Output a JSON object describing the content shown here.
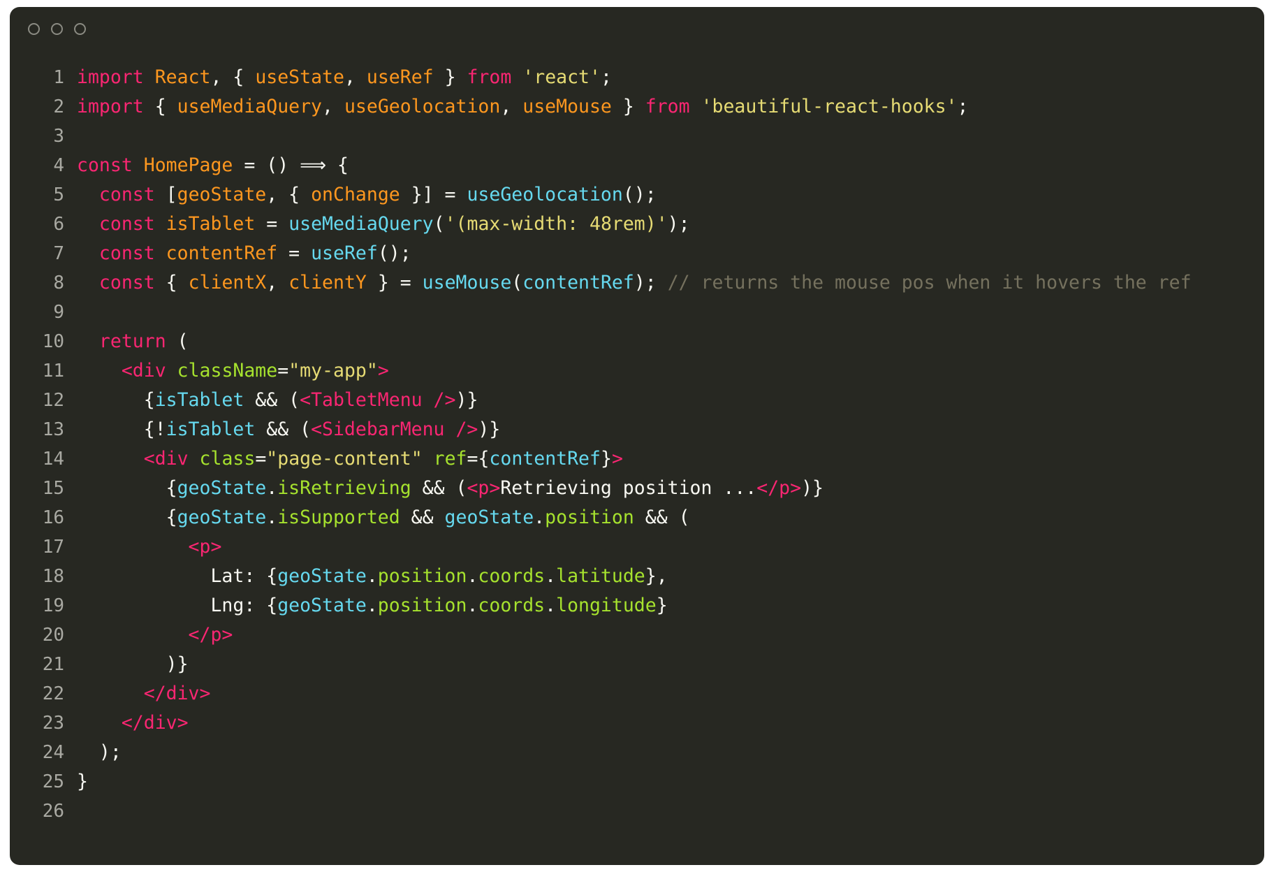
{
  "window": {
    "title_bar": {
      "buttons": [
        {
          "name": "close-button",
          "icon": "circle-outline-icon"
        },
        {
          "name": "minimize-button",
          "icon": "circle-outline-icon"
        },
        {
          "name": "maximize-button",
          "icon": "circle-outline-icon"
        }
      ]
    },
    "background": "#272822",
    "page_background": "#ffffff"
  },
  "editor": {
    "language": "jsx",
    "total_lines": 26,
    "gutter_color": "#a9a9a2",
    "colors": {
      "keyword": "#f92672",
      "identifier": "#fd971f",
      "string": "#e6db74",
      "function": "#66d9ef",
      "property": "#a6e22e",
      "punctuation": "#f8f8f2",
      "comment": "#75715e",
      "tag": "#f92672"
    },
    "lines": [
      {
        "number": "1",
        "tokens": [
          {
            "t": "import",
            "c": "kw"
          },
          {
            "t": " ",
            "c": "punc"
          },
          {
            "t": "React",
            "c": "id"
          },
          {
            "t": ", { ",
            "c": "punc"
          },
          {
            "t": "useState",
            "c": "id"
          },
          {
            "t": ", ",
            "c": "punc"
          },
          {
            "t": "useRef",
            "c": "id"
          },
          {
            "t": " } ",
            "c": "punc"
          },
          {
            "t": "from",
            "c": "kw"
          },
          {
            "t": " ",
            "c": "punc"
          },
          {
            "t": "'react'",
            "c": "str"
          },
          {
            "t": ";",
            "c": "punc"
          }
        ]
      },
      {
        "number": "2",
        "tokens": [
          {
            "t": "import",
            "c": "kw"
          },
          {
            "t": " { ",
            "c": "punc"
          },
          {
            "t": "useMediaQuery",
            "c": "id"
          },
          {
            "t": ", ",
            "c": "punc"
          },
          {
            "t": "useGeolocation",
            "c": "id"
          },
          {
            "t": ", ",
            "c": "punc"
          },
          {
            "t": "useMouse",
            "c": "id"
          },
          {
            "t": " } ",
            "c": "punc"
          },
          {
            "t": "from",
            "c": "kw"
          },
          {
            "t": " ",
            "c": "punc"
          },
          {
            "t": "'beautiful-react-hooks'",
            "c": "str"
          },
          {
            "t": ";",
            "c": "punc"
          }
        ]
      },
      {
        "number": "3",
        "tokens": []
      },
      {
        "number": "4",
        "tokens": [
          {
            "t": "const",
            "c": "kw"
          },
          {
            "t": " ",
            "c": "punc"
          },
          {
            "t": "HomePage",
            "c": "id"
          },
          {
            "t": " = () ⟹ {",
            "c": "punc"
          }
        ]
      },
      {
        "number": "5",
        "tokens": [
          {
            "t": "  ",
            "c": "punc"
          },
          {
            "t": "const",
            "c": "kw"
          },
          {
            "t": " [",
            "c": "punc"
          },
          {
            "t": "geoState",
            "c": "id"
          },
          {
            "t": ", { ",
            "c": "punc"
          },
          {
            "t": "onChange",
            "c": "id"
          },
          {
            "t": " }] = ",
            "c": "punc"
          },
          {
            "t": "useGeolocation",
            "c": "fn"
          },
          {
            "t": "();",
            "c": "punc"
          }
        ]
      },
      {
        "number": "6",
        "tokens": [
          {
            "t": "  ",
            "c": "punc"
          },
          {
            "t": "const",
            "c": "kw"
          },
          {
            "t": " ",
            "c": "punc"
          },
          {
            "t": "isTablet",
            "c": "id"
          },
          {
            "t": " = ",
            "c": "punc"
          },
          {
            "t": "useMediaQuery",
            "c": "fn"
          },
          {
            "t": "(",
            "c": "punc"
          },
          {
            "t": "'(max-width: 48rem)'",
            "c": "str"
          },
          {
            "t": ");",
            "c": "punc"
          }
        ]
      },
      {
        "number": "7",
        "tokens": [
          {
            "t": "  ",
            "c": "punc"
          },
          {
            "t": "const",
            "c": "kw"
          },
          {
            "t": " ",
            "c": "punc"
          },
          {
            "t": "contentRef",
            "c": "id"
          },
          {
            "t": " = ",
            "c": "punc"
          },
          {
            "t": "useRef",
            "c": "fn"
          },
          {
            "t": "();",
            "c": "punc"
          }
        ]
      },
      {
        "number": "8",
        "tokens": [
          {
            "t": "  ",
            "c": "punc"
          },
          {
            "t": "const",
            "c": "kw"
          },
          {
            "t": " { ",
            "c": "punc"
          },
          {
            "t": "clientX",
            "c": "id"
          },
          {
            "t": ", ",
            "c": "punc"
          },
          {
            "t": "clientY",
            "c": "id"
          },
          {
            "t": " } = ",
            "c": "punc"
          },
          {
            "t": "useMouse",
            "c": "fn"
          },
          {
            "t": "(",
            "c": "punc"
          },
          {
            "t": "contentRef",
            "c": "fn"
          },
          {
            "t": "); ",
            "c": "punc"
          },
          {
            "t": "// returns the mouse pos when it hovers the ref",
            "c": "cmt"
          }
        ]
      },
      {
        "number": "9",
        "tokens": []
      },
      {
        "number": "10",
        "tokens": [
          {
            "t": "  ",
            "c": "punc"
          },
          {
            "t": "return",
            "c": "kw"
          },
          {
            "t": " (",
            "c": "punc"
          }
        ]
      },
      {
        "number": "11",
        "tokens": [
          {
            "t": "    ",
            "c": "punc"
          },
          {
            "t": "<div",
            "c": "tag"
          },
          {
            "t": " ",
            "c": "punc"
          },
          {
            "t": "className",
            "c": "attr"
          },
          {
            "t": "=",
            "c": "punc"
          },
          {
            "t": "\"my-app\"",
            "c": "str"
          },
          {
            "t": ">",
            "c": "tag"
          }
        ]
      },
      {
        "number": "12",
        "tokens": [
          {
            "t": "      {",
            "c": "punc"
          },
          {
            "t": "isTablet",
            "c": "fn"
          },
          {
            "t": " && (",
            "c": "punc"
          },
          {
            "t": "<TabletMenu />",
            "c": "tag"
          },
          {
            "t": ")}",
            "c": "punc"
          }
        ]
      },
      {
        "number": "13",
        "tokens": [
          {
            "t": "      {!",
            "c": "punc"
          },
          {
            "t": "isTablet",
            "c": "fn"
          },
          {
            "t": " && (",
            "c": "punc"
          },
          {
            "t": "<SidebarMenu />",
            "c": "tag"
          },
          {
            "t": ")}",
            "c": "punc"
          }
        ]
      },
      {
        "number": "14",
        "tokens": [
          {
            "t": "      ",
            "c": "punc"
          },
          {
            "t": "<div",
            "c": "tag"
          },
          {
            "t": " ",
            "c": "punc"
          },
          {
            "t": "class",
            "c": "attr"
          },
          {
            "t": "=",
            "c": "punc"
          },
          {
            "t": "\"page-content\"",
            "c": "str"
          },
          {
            "t": " ",
            "c": "punc"
          },
          {
            "t": "ref",
            "c": "attr"
          },
          {
            "t": "={",
            "c": "punc"
          },
          {
            "t": "contentRef",
            "c": "fn"
          },
          {
            "t": "}",
            "c": "punc"
          },
          {
            "t": ">",
            "c": "tag"
          }
        ]
      },
      {
        "number": "15",
        "tokens": [
          {
            "t": "        {",
            "c": "punc"
          },
          {
            "t": "geoState",
            "c": "fn"
          },
          {
            "t": ".",
            "c": "punc"
          },
          {
            "t": "isRetrieving",
            "c": "prop"
          },
          {
            "t": " && (",
            "c": "punc"
          },
          {
            "t": "<p>",
            "c": "tag"
          },
          {
            "t": "Retrieving position ...",
            "c": "punc"
          },
          {
            "t": "</p>",
            "c": "tag"
          },
          {
            "t": ")}",
            "c": "punc"
          }
        ]
      },
      {
        "number": "16",
        "tokens": [
          {
            "t": "        {",
            "c": "punc"
          },
          {
            "t": "geoState",
            "c": "fn"
          },
          {
            "t": ".",
            "c": "punc"
          },
          {
            "t": "isSupported",
            "c": "prop"
          },
          {
            "t": " && ",
            "c": "punc"
          },
          {
            "t": "geoState",
            "c": "fn"
          },
          {
            "t": ".",
            "c": "punc"
          },
          {
            "t": "position",
            "c": "prop"
          },
          {
            "t": " && (",
            "c": "punc"
          }
        ]
      },
      {
        "number": "17",
        "tokens": [
          {
            "t": "          ",
            "c": "punc"
          },
          {
            "t": "<p>",
            "c": "tag"
          }
        ]
      },
      {
        "number": "18",
        "tokens": [
          {
            "t": "            Lat: {",
            "c": "punc"
          },
          {
            "t": "geoState",
            "c": "fn"
          },
          {
            "t": ".",
            "c": "punc"
          },
          {
            "t": "position",
            "c": "prop"
          },
          {
            "t": ".",
            "c": "punc"
          },
          {
            "t": "coords",
            "c": "prop"
          },
          {
            "t": ".",
            "c": "punc"
          },
          {
            "t": "latitude",
            "c": "prop"
          },
          {
            "t": "},",
            "c": "punc"
          }
        ]
      },
      {
        "number": "19",
        "tokens": [
          {
            "t": "            Lng: {",
            "c": "punc"
          },
          {
            "t": "geoState",
            "c": "fn"
          },
          {
            "t": ".",
            "c": "punc"
          },
          {
            "t": "position",
            "c": "prop"
          },
          {
            "t": ".",
            "c": "punc"
          },
          {
            "t": "coords",
            "c": "prop"
          },
          {
            "t": ".",
            "c": "punc"
          },
          {
            "t": "longitude",
            "c": "prop"
          },
          {
            "t": "}",
            "c": "punc"
          }
        ]
      },
      {
        "number": "20",
        "tokens": [
          {
            "t": "          ",
            "c": "punc"
          },
          {
            "t": "</p>",
            "c": "tag"
          }
        ]
      },
      {
        "number": "21",
        "tokens": [
          {
            "t": "        )}",
            "c": "punc"
          }
        ]
      },
      {
        "number": "22",
        "tokens": [
          {
            "t": "      ",
            "c": "punc"
          },
          {
            "t": "</div>",
            "c": "tag"
          }
        ]
      },
      {
        "number": "23",
        "tokens": [
          {
            "t": "    ",
            "c": "punc"
          },
          {
            "t": "</div>",
            "c": "tag"
          }
        ]
      },
      {
        "number": "24",
        "tokens": [
          {
            "t": "  );",
            "c": "punc"
          }
        ]
      },
      {
        "number": "25",
        "tokens": [
          {
            "t": "}",
            "c": "punc"
          }
        ]
      },
      {
        "number": "26",
        "tokens": []
      }
    ]
  }
}
